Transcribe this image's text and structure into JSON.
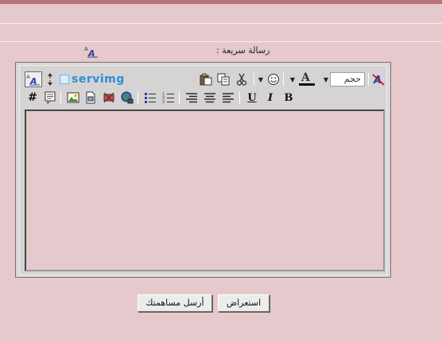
{
  "quick_reply": {
    "title": "رسالة سريعة :",
    "toggle_icon": "text-format-toggle-icon"
  },
  "toolbar": {
    "row1": {
      "mode_icon": "wysiwyg-toggle-icon",
      "resize_icon": "resize-arrows-icon",
      "servimg_label": "servimg",
      "paste_icon": "paste-icon",
      "copy_icon": "copy-icon",
      "cut_icon": "cut-icon",
      "smiley_icon": "smiley-icon",
      "font_color_icon": "font-color-icon",
      "size_label": "حجم",
      "remove_format_icon": "remove-format-icon"
    },
    "row2": {
      "hash_label": "#",
      "quote_icon": "quote-icon",
      "image_icon": "image-icon",
      "file_icon": "file-icon",
      "video_icon": "video-icon",
      "link_icon": "link-globe-icon",
      "bullet_list_icon": "bullet-list-icon",
      "numbered_list_icon": "numbered-list-icon",
      "align_right_icon": "align-right-icon",
      "align_center_icon": "align-center-icon",
      "align_left_icon": "align-left-icon",
      "underline_label": "U",
      "italic_label": "I",
      "bold_label": "B"
    }
  },
  "editor": {
    "content": ""
  },
  "actions": {
    "preview_label": "استعراض",
    "submit_label": "أرسل مساهمتك"
  },
  "colors": {
    "page_bg": "#e6c9cc",
    "top_bar": "#b87478",
    "servimg": "#2a8fd6"
  }
}
